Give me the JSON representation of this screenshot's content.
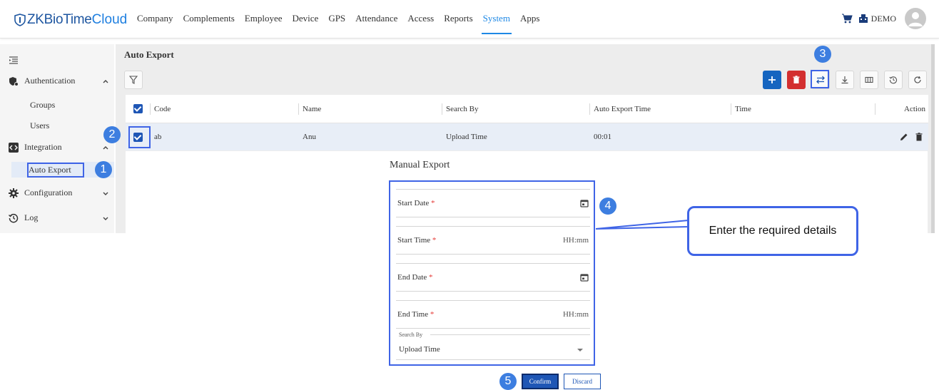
{
  "brand": {
    "prefix": "ZKBioTime",
    "suffix": "Cloud"
  },
  "nav": {
    "items": [
      "Company",
      "Complements",
      "Employee",
      "Device",
      "GPS",
      "Attendance",
      "Access",
      "Reports",
      "System",
      "Apps"
    ],
    "active": "System"
  },
  "user": {
    "org_label": "DEMO"
  },
  "sidebar": {
    "groups": [
      {
        "label": "Authentication",
        "icon": "shield-gear-icon",
        "expanded": true,
        "items": [
          "Groups",
          "Users"
        ]
      },
      {
        "label": "Integration",
        "icon": "integration-icon",
        "expanded": true,
        "items": [
          "Auto Export"
        ]
      },
      {
        "label": "Configuration",
        "icon": "gear-icon",
        "expanded": false,
        "items": []
      },
      {
        "label": "Log",
        "icon": "history-icon",
        "expanded": false,
        "items": []
      }
    ],
    "active_item": "Auto Export"
  },
  "page": {
    "title": "Auto Export"
  },
  "table": {
    "columns": [
      "Code",
      "Name",
      "Search By",
      "Auto Export Time",
      "Time",
      "Action"
    ],
    "rows": [
      {
        "code": "ab",
        "name": "Anu",
        "search_by": "Upload Time",
        "auto_export_time": "00:01",
        "time": "",
        "checked": true
      }
    ]
  },
  "dialog": {
    "title": "Manual Export",
    "fields": {
      "start_date": {
        "label": "Start Date",
        "required": "*"
      },
      "start_time": {
        "label": "Start Time",
        "required": "*",
        "placeholder": "HH:mm"
      },
      "end_date": {
        "label": "End Date",
        "required": "*"
      },
      "end_time": {
        "label": "End Time",
        "required": "*",
        "placeholder": "HH:mm"
      },
      "search_by": {
        "label": "Search By",
        "value": "Upload Time"
      }
    },
    "confirm": "Confirm",
    "discard": "Discard"
  },
  "annotations": {
    "badges": [
      "1",
      "2",
      "3",
      "4",
      "5"
    ],
    "callout": "Enter the required details",
    "color": "#3f64e6"
  },
  "colors": {
    "primary": "#1e56b5",
    "active_nav": "#1e88e5",
    "delete": "#d32f2f",
    "add": "#1565c0"
  }
}
